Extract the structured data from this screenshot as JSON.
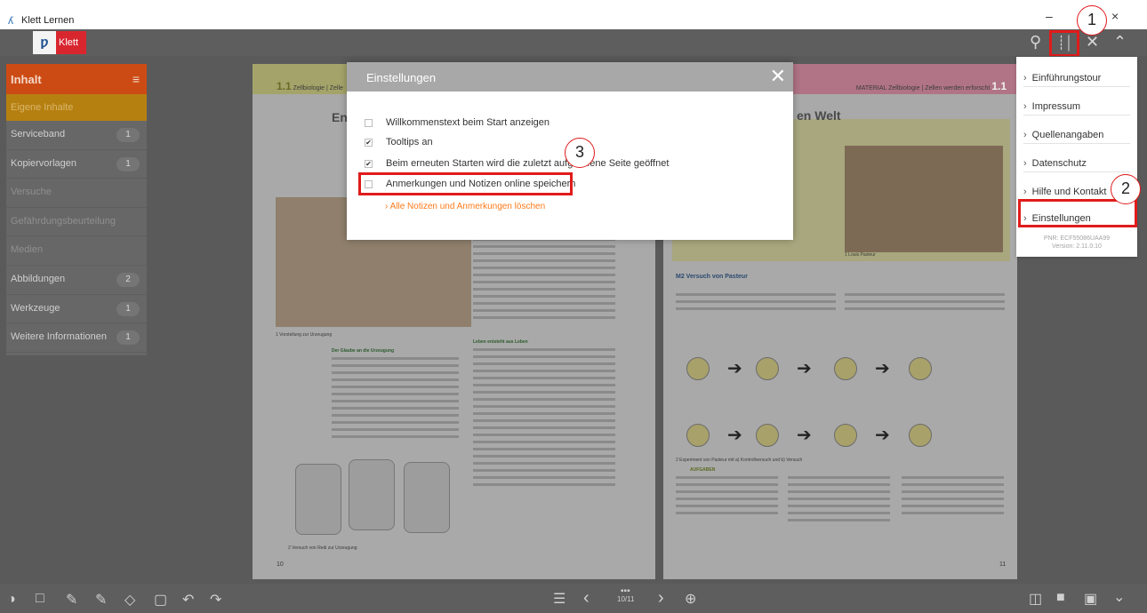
{
  "window": {
    "title": "Klett Lernen",
    "minimize": "–",
    "close": "×"
  },
  "toolbar": {
    "logo_text": "Klett",
    "logo_mark": "ƿ",
    "icons": {
      "search": "search-icon",
      "tools": "tools-icon",
      "close": "close-icon",
      "collapse": "chevron-up-icon"
    }
  },
  "sidebar": {
    "header": "Inhalt",
    "active_item": "Eigene Inhalte",
    "items": [
      {
        "label": "Serviceband",
        "count": "1",
        "enabled": true
      },
      {
        "label": "Kopiervorlagen",
        "count": "1",
        "enabled": true
      },
      {
        "label": "Versuche",
        "count": "",
        "enabled": false
      },
      {
        "label": "Gefährdungsbeurteilung",
        "count": "",
        "enabled": false
      },
      {
        "label": "Medien",
        "count": "",
        "enabled": false
      },
      {
        "label": "Abbildungen",
        "count": "2",
        "enabled": true
      },
      {
        "label": "Werkzeuge",
        "count": "1",
        "enabled": true
      },
      {
        "label": "Weitere Informationen",
        "count": "1",
        "enabled": true
      }
    ]
  },
  "book": {
    "left_page": {
      "chapter": "1.1",
      "header": "Zellbiologie | Zelle",
      "heading": "En",
      "caption_1": "1   Vorstellung zur Urzeugung",
      "caption_2": "2   Versuch von Redi zur Urzeugung",
      "section_1": "Der Glaube an die Urzeugung",
      "section_2": "Leben entsteht aus Leben",
      "page_number": "10"
    },
    "right_page": {
      "chapter": "1.1",
      "header": "MATERIAL Zellbiologie | Zellen werden erforscht",
      "heading": "en Welt",
      "material": "M2 Versuch von Pasteur",
      "portrait_caption": "1   Louis Pasteur",
      "experiment_caption": "2   Experiment von Pasteur mit a) Kontrollversuch und b) Versuch",
      "tasks_heading": "AUFGABEN",
      "page_number": "11"
    }
  },
  "modal": {
    "title": "Einstellungen",
    "options": [
      {
        "label": "Willkommenstext beim Start anzeigen",
        "checked": false
      },
      {
        "label": "Tooltips an",
        "checked": true
      },
      {
        "label": "Beim erneuten Starten wird die zuletzt aufgerufene Seite geöffnet",
        "checked": true
      },
      {
        "label": "Anmerkungen und Notizen online speichern",
        "checked": false
      }
    ],
    "delete_link": "Alle Notizen und Anmerkungen löschen"
  },
  "dropdown": {
    "items": [
      "Einführungstour",
      "Impressum",
      "Quellenangaben",
      "Datenschutz",
      "Hilfe und Kontakt",
      "Einstellungen"
    ],
    "pnr": "PNR: ECF55086UAA99",
    "version": "Version: 2.11.0.10"
  },
  "callouts": [
    "1",
    "2",
    "3"
  ],
  "bottombar": {
    "page_counter": "10/11"
  },
  "colors": {
    "highlight": "#e01b1b",
    "sidebar_header": "#cc4b14",
    "link": "#ff7a1a"
  }
}
